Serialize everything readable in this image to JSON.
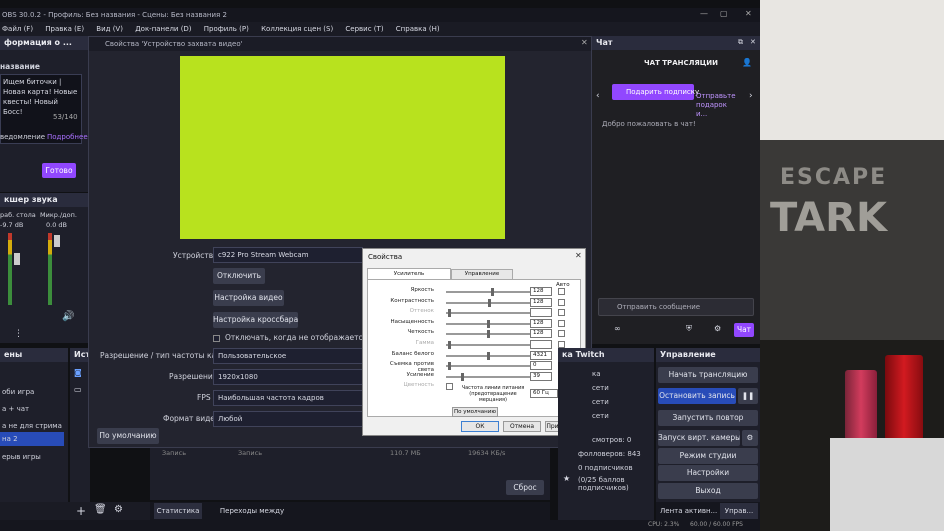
{
  "titlebar": {
    "text": "OBS 30.0.2 - Профиль: Без названия - Сцены: Без названия 2",
    "buttons": [
      "—",
      "▢",
      "✕"
    ]
  },
  "menu": [
    "Файл (F)",
    "Правка (E)",
    "Вид (V)",
    "Док-панели (D)",
    "Профиль (P)",
    "Коллекция сцен (S)",
    "Сервис (T)",
    "Справка (H)"
  ],
  "stream_info": {
    "dock_title": "формация о ...",
    "name_label": "название",
    "title_text": [
      "Ищем биточки |",
      "Новая карта! Новые",
      "квесты! Новый Босс!"
    ],
    "counter": "53/140",
    "notify_prefix": "ведомление",
    "notify_link": "Подробнее",
    "done_button": "Готово"
  },
  "mixer": {
    "title": "кшер звука",
    "channels": [
      {
        "name": "раб. стола",
        "db": "-9.7 dB"
      },
      {
        "name": "Микр./доп.",
        "db": "0.0 dB"
      }
    ]
  },
  "scenes": {
    "title": "ены",
    "items": [
      "оби игра",
      "а + чат",
      "а не для стрима",
      "на 2",
      "ерыв игры"
    ],
    "selected": 3
  },
  "sources": {
    "title": "Ист"
  },
  "capture_dialog": {
    "title": "Свойства 'Устройство захвата видео'",
    "preview_color": "#b8e21e",
    "device_label": "Устройство",
    "device_value": "c922 Pro Stream Webcam",
    "buttons": [
      "Отключить",
      "Настройка видео",
      "Настройка кроссбара"
    ],
    "hide_checkbox": "Отключать, когда не отображается",
    "resolution_type_label": "Разрешение / тип частоты кадров",
    "resolution_type_value": "Пользовательское",
    "resolution_label": "Разрешение",
    "resolution_value": "1920x1080",
    "fps_label": "FPS",
    "fps_value": "Наибольшая частота кадров",
    "video_format_label": "Формат видео",
    "video_format_value": "Любой",
    "defaults_button": "По умолчанию"
  },
  "props_dialog": {
    "title": "Свойства",
    "tabs": [
      "Усилитель видеопроцессора",
      "Управление камерой"
    ],
    "auto_label": "Авто",
    "rows": [
      {
        "label": "Яркость",
        "value": "128",
        "pos": 0.55,
        "enabled": true,
        "auto": false
      },
      {
        "label": "Контрастность",
        "value": "128",
        "pos": 0.52,
        "enabled": true,
        "auto": false
      },
      {
        "label": "Оттенок",
        "value": "",
        "pos": 0.02,
        "enabled": false,
        "auto": false
      },
      {
        "label": "Насыщенность",
        "value": "128",
        "pos": 0.5,
        "enabled": true,
        "auto": false
      },
      {
        "label": "Четкость",
        "value": "128",
        "pos": 0.5,
        "enabled": true,
        "auto": false
      },
      {
        "label": "Гамма",
        "value": "",
        "pos": 0.02,
        "enabled": false,
        "auto": false
      },
      {
        "label": "Баланс белого",
        "value": "4321",
        "pos": 0.5,
        "enabled": true,
        "auto": true
      },
      {
        "label": "Съемка против света",
        "value": "0",
        "pos": 0.02,
        "enabled": true,
        "auto": false
      },
      {
        "label": "Усиление",
        "value": "39",
        "pos": 0.18,
        "enabled": true,
        "auto": false
      },
      {
        "label": "Цветность",
        "value": "",
        "pos": 0.0,
        "enabled": false,
        "auto": false
      }
    ],
    "powerline_label": "Частота линии питания (предотвращение мерцания)",
    "powerline_value": "60 Гц",
    "default_button": "По умолчанию",
    "ok": "ОК",
    "cancel": "Отмена",
    "apply": "Применить"
  },
  "bottom": {
    "rec_label": "Запись",
    "rec_col2": "Запись",
    "rec_size": "110.7 МБ",
    "rec_size2": "19634 КБ/s",
    "reset": "Сброс",
    "tabs": [
      "Статистика",
      "Переходы между сценами"
    ]
  },
  "chat": {
    "dock_title": "Чат",
    "header": "ЧАТ ТРАНСЛЯЦИИ",
    "gift_button": "Подарить подписку",
    "gift_side": "Отправьте подарок и...",
    "welcome": "Добро пожаловать в чат!",
    "input_placeholder": "Отправить сообщение",
    "chat_button": "Чат",
    "count": "∞"
  },
  "twitch": {
    "title": "ка Twitch",
    "lines": [
      "ка",
      "сети",
      "сети",
      "сети",
      "смотров: 0",
      "фолловеров: 843",
      "0 подписчиков",
      "(0/25 баллов подписчиков)"
    ]
  },
  "controls": {
    "title": "Управление",
    "buttons": [
      "Начать трансляцию",
      "Остановить запись",
      "Запустить повтор",
      "Запуск вирт. камеры",
      "Режим студии",
      "Настройки",
      "Выход"
    ],
    "active": "Лента активн...",
    "manage": "Управ..."
  },
  "status_bar": {
    "cpu": "CPU: 2.3%",
    "fps": "60.00 / 60.00 FPS"
  },
  "background": {
    "game_logo": "ESCAPE",
    "game_logo2": "TARK"
  },
  "colors": {
    "accent": "#9147ff",
    "dock": "#1e1f2a",
    "preview": "#b8e21e",
    "obs_blue": "#284cb8"
  }
}
